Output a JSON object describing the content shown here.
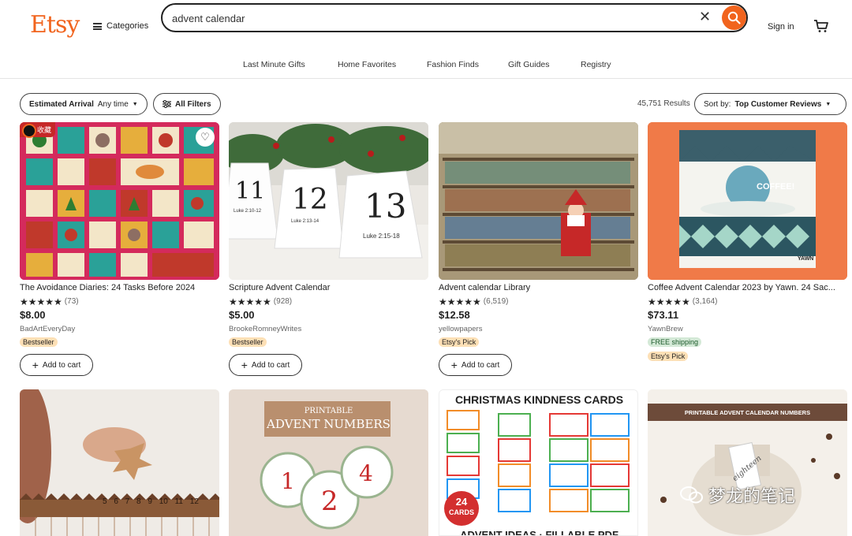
{
  "header": {
    "logo": "Etsy",
    "categories_label": "Categories",
    "search_value": "advent calendar",
    "clear_symbol": "✕",
    "signin_label": "Sign in",
    "brand_color": "#f1641e"
  },
  "nav": [
    "Last Minute Gifts",
    "Home Favorites",
    "Fashion Finds",
    "Gift Guides",
    "Registry"
  ],
  "filters": {
    "arrival_label": "Estimated Arrival",
    "arrival_value": "Any time",
    "all_filters": "All Filters",
    "results": "45,751 Results",
    "sort_label": "Sort by:",
    "sort_value": "Top Customer Reviews"
  },
  "cards": [
    {
      "title": "The Avoidance Diaries: 24 Tasks Before 2024",
      "stars": "★★★★★",
      "count": "(73)",
      "price": "$8.00",
      "shop": "BadArtEveryDay",
      "badges": [
        "Bestseller"
      ],
      "add": "Add to cart",
      "overlay_tag": "收藏"
    },
    {
      "title": "Scripture Advent Calendar",
      "stars": "★★★★★",
      "count": "(928)",
      "price": "$5.00",
      "shop": "BrookeRomneyWrites",
      "badges": [
        "Bestseller"
      ],
      "add": "Add to cart",
      "numbers": [
        "11",
        "12",
        "13"
      ],
      "verses": [
        "Luke 2:10-12",
        "Luke 2:13-14",
        "Luke 2:15-18"
      ]
    },
    {
      "title": "Advent calendar Library",
      "stars": "★★★★★",
      "count": "(6,519)",
      "price": "$12.58",
      "shop": "yellowpapers",
      "badges": [
        "Etsy's Pick"
      ],
      "add": "Add to cart"
    },
    {
      "title": "Coffee Advent Calendar 2023 by Yawn. 24 Sac...",
      "stars": "★★★★★",
      "count": "(3,164)",
      "price": "$73.11",
      "shop": "YawnBrew",
      "badges": [
        "FREE shipping",
        "Etsy's Pick"
      ],
      "img_text": "COFFEE!",
      "img_brand": "YAWN"
    }
  ],
  "row2": [
    {
      "alt": "wooden advent ruler",
      "numbers": "5 6 7 8 9 10 11 12"
    },
    {
      "heading_small": "PRINTABLE",
      "heading": "ADVENT NUMBERS",
      "tags": [
        "1",
        "2",
        "4"
      ]
    },
    {
      "heading": "CHRISTMAS KINDNESS CARDS",
      "badge_num": "24",
      "badge_txt": "CARDS",
      "footer": "ADVENT IDEAS · FILLABLE PDF"
    },
    {
      "heading": "PRINTABLE ADVENT CALENDAR NUMBERS",
      "tag_text": "eighteen"
    }
  ],
  "watermark": "梦龙的笔记"
}
